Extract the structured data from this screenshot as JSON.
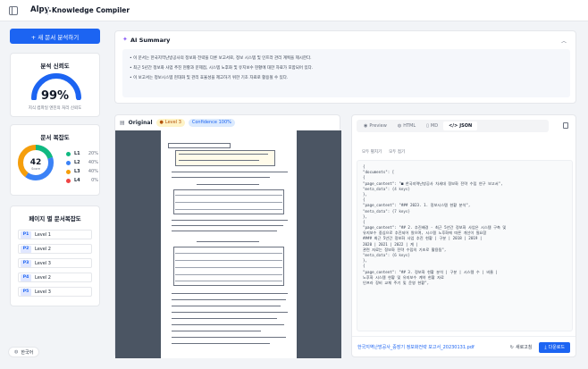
{
  "app": {
    "logo": "Alpy.",
    "title": "Knowledge Compiler"
  },
  "sidebar": {
    "new_button": "+ 새 문서 분석하기",
    "reliability": {
      "title": "분석 신뢰도",
      "value": "99%",
      "caption": "지식 컴파일 엔진의 처리 신뢰도",
      "fraction": 0.99
    },
    "complexity": {
      "title": "문서 복잡도",
      "score": "42",
      "score_label": "Score",
      "levels": [
        {
          "name": "L1",
          "value": "20%",
          "pct": 20,
          "color": "#10b981"
        },
        {
          "name": "L2",
          "value": "40%",
          "pct": 40,
          "color": "#3b82f6"
        },
        {
          "name": "L3",
          "value": "40%",
          "pct": 40,
          "color": "#f59e0b"
        },
        {
          "name": "L4",
          "value": "0%",
          "pct": 0,
          "color": "#ef4444"
        }
      ]
    },
    "pages": {
      "title": "페이지 별 문서복잡도",
      "items": [
        {
          "page": "P1",
          "level": "Level 1"
        },
        {
          "page": "P2",
          "level": "Level 2"
        },
        {
          "page": "P3",
          "level": "Level 3"
        },
        {
          "page": "P4",
          "level": "Level 2"
        },
        {
          "page": "P5",
          "level": "Level 3"
        }
      ]
    },
    "language": "한국어"
  },
  "summary": {
    "title": "AI Summary",
    "lines": [
      "이 문서는 한국지역난방공사의 정보화 전략을 다룬 보고서로, 정보 시스템 및 인프라 관리 계획을 제시한다.",
      "최근 5년간 정보화 사업 추진 현황과 문제점, 시스템 노후화 및 유지보수 현황에 대한 자료가 포함되어 있다.",
      "이 보고서는 정보시스템 현대화 및 관리 효율성을 제고하기 위한 기초 자료로 활용될 수 있다."
    ]
  },
  "original": {
    "title": "Original",
    "level_badge": "Level 3",
    "confidence_badge": "Confidence 100%"
  },
  "output": {
    "tabs": [
      "Preview",
      "HTML",
      "MD",
      "JSON"
    ],
    "tools": [
      "모두 펼치기",
      "모두 접기"
    ],
    "json_lines": [
      "{",
      "  \"documents\": [",
      "    {",
      "      \"page_content\": \"■ 한국지역난방공사 차세대 정보화 전략 수립 연구 보고서\",",
      "      \"meta_data\": {4 keys}",
      "    },",
      "    {",
      "      \"page_content\": \"### 2023. 1. 정보시스템 현황 분석\",",
      "      \"meta_data\": {7 keys}",
      "    },",
      "    {",
      "      \"page_content\": \"## 2. 추진배경 - 최근 5년간 정보화 사업은 시스템 구축 및",
      "        유지보수 중심으로 추진되어 왔으며, 시스템 노후화에 따른 개선이 필요함",
      "        #### 최근 5년간 정보화 사업 추진 현황 | 구분 | 2018 | 2019 |",
      "        2020 | 2021 | 2022 | 계 |",
      "        관련 자료는 정보화 전략 수립의 기초로 활용됨\",",
      "      \"meta_data\": {6 keys}",
      "    },",
      "    {",
      "      \"page_content\": \"## 3. 정보화 현황 분석 | 구분 | 시스템 수 | 비율 |",
      "        노후화 시스템 현황 및 유지보수 계약 현황 자료",
      "        인프라 장비 교체 주기 및 운영 현황\","
    ],
    "file_name": "한국지역난방공사_중장기 정보화전략 보고서_20230131.pdf",
    "refresh": "새로고침",
    "download": "다운로드"
  }
}
